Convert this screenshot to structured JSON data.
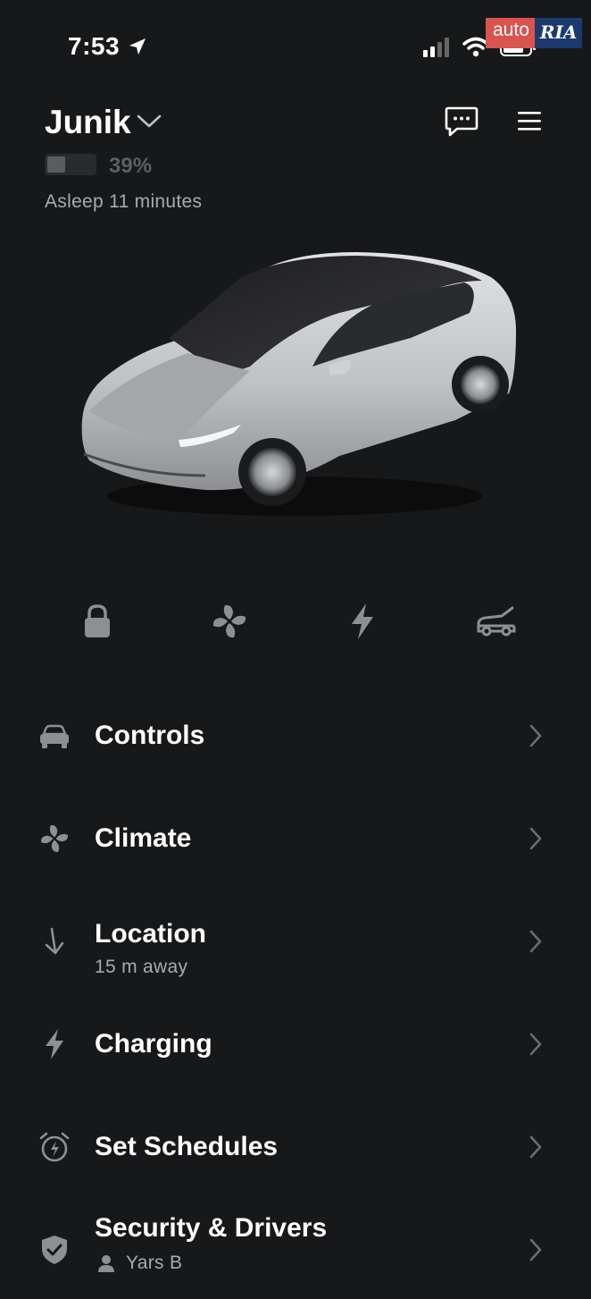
{
  "status_bar": {
    "time": "7:53"
  },
  "watermark": {
    "left": "auto",
    "right": "RIA"
  },
  "header": {
    "vehicle_name": "Junik",
    "battery_percent_label": "39%",
    "battery_level": 0.39,
    "vehicle_status": "Asleep 11 minutes"
  },
  "quick_actions": [
    {
      "icon": "lock-icon"
    },
    {
      "icon": "fan-icon"
    },
    {
      "icon": "bolt-icon"
    },
    {
      "icon": "frunk-icon"
    }
  ],
  "menu": {
    "controls": {
      "label": "Controls",
      "icon": "car-icon"
    },
    "climate": {
      "label": "Climate",
      "icon": "fan-icon"
    },
    "location": {
      "label": "Location",
      "sub": "15 m away",
      "icon": "arrow-down-icon"
    },
    "charging": {
      "label": "Charging",
      "icon": "bolt-icon"
    },
    "schedules": {
      "label": "Set Schedules",
      "icon": "alarm-clock-icon"
    },
    "security": {
      "label": "Security & Drivers",
      "sub": "Yars B",
      "icon": "shield-icon"
    }
  },
  "colors": {
    "background": "#17181a",
    "text": "#ffffff",
    "muted": "#a9aaad",
    "icon": "#8e8f93"
  }
}
